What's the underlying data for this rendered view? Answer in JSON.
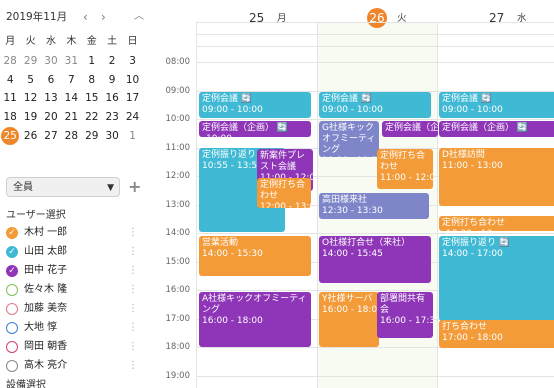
{
  "mini_calendar": {
    "title": "2019年11月",
    "prev": "‹",
    "next": "›",
    "collapse": "︿",
    "weekdays": [
      "月",
      "火",
      "水",
      "木",
      "金",
      "土",
      "日"
    ],
    "weeks": [
      [
        {
          "d": "28",
          "dim": true
        },
        {
          "d": "29",
          "dim": true
        },
        {
          "d": "30",
          "dim": true
        },
        {
          "d": "31",
          "dim": true
        },
        {
          "d": "1"
        },
        {
          "d": "2"
        },
        {
          "d": "3"
        }
      ],
      [
        {
          "d": "4"
        },
        {
          "d": "5"
        },
        {
          "d": "6"
        },
        {
          "d": "7"
        },
        {
          "d": "8"
        },
        {
          "d": "9"
        },
        {
          "d": "10"
        }
      ],
      [
        {
          "d": "11"
        },
        {
          "d": "12"
        },
        {
          "d": "13"
        },
        {
          "d": "14"
        },
        {
          "d": "15"
        },
        {
          "d": "16"
        },
        {
          "d": "17"
        }
      ],
      [
        {
          "d": "18"
        },
        {
          "d": "19"
        },
        {
          "d": "20"
        },
        {
          "d": "21"
        },
        {
          "d": "22"
        },
        {
          "d": "23"
        },
        {
          "d": "24"
        }
      ],
      [
        {
          "d": "25",
          "today": true
        },
        {
          "d": "26"
        },
        {
          "d": "27"
        },
        {
          "d": "28"
        },
        {
          "d": "29"
        },
        {
          "d": "30"
        },
        {
          "d": "1",
          "dim": true
        }
      ]
    ]
  },
  "filter": {
    "label": "全員",
    "add": "+"
  },
  "users_section": {
    "title": "ユーザー選択"
  },
  "users": [
    {
      "name": "木村 一郎",
      "checked": true,
      "color": "#f29b38"
    },
    {
      "name": "山田 太郎",
      "checked": true,
      "color": "#3fb9d4"
    },
    {
      "name": "田中 花子",
      "checked": true,
      "color": "#8e35b8"
    },
    {
      "name": "佐々木 隆",
      "checked": false,
      "color": "#7cc05a"
    },
    {
      "name": "加藤 美奈",
      "checked": false,
      "color": "#e07a8a"
    },
    {
      "name": "大地 惇",
      "checked": false,
      "color": "#3a7fd5"
    },
    {
      "name": "岡田 朝香",
      "checked": false,
      "color": "#d04070"
    },
    {
      "name": "高木 亮介",
      "checked": false,
      "color": "#888888"
    }
  ],
  "equipment_section": {
    "title": "設備選択"
  },
  "days": [
    {
      "num": "25",
      "wd": "月",
      "today": false
    },
    {
      "num": "26",
      "wd": "火",
      "today": true
    },
    {
      "num": "27",
      "wd": "水",
      "today": false
    }
  ],
  "times": [
    "08:00",
    "09:00",
    "10:00",
    "11:00",
    "12:00",
    "13:00",
    "14:00",
    "15:00",
    "16:00",
    "17:00",
    "18:00",
    "19:00"
  ],
  "events": [
    {
      "day": 0,
      "title": "定例会議",
      "time": "09:00 - 10:00",
      "color": "teal",
      "repeat": true
    },
    {
      "day": 0,
      "title": "定例会議（企画）",
      "time": "10:00",
      "color": "purple",
      "repeat": true,
      "one": true
    },
    {
      "day": 0,
      "title": "定例振り返り",
      "time": "10:55 - 13:55",
      "color": "teal",
      "repeat": true
    },
    {
      "day": 0,
      "title": "新案件プレスト会議",
      "time": "11:00 - 12:00",
      "color": "purple"
    },
    {
      "day": 0,
      "title": "定例打ち合わせ",
      "time": "12:00 - 13:00",
      "color": "orange"
    },
    {
      "day": 0,
      "title": "営業活動",
      "time": "14:00 - 15:30",
      "color": "orange"
    },
    {
      "day": 0,
      "title": "A社様キックオフミーティング",
      "time": "16:00 - 18:00",
      "color": "purple"
    },
    {
      "day": 1,
      "title": "定例会議",
      "time": "09:00 - 10:00",
      "color": "teal",
      "repeat": true
    },
    {
      "day": 1,
      "title": "G社様キックオフミーティング",
      "time": "10:00 - 11:30",
      "color": "slate"
    },
    {
      "day": 1,
      "title": "定例会議（企",
      "time": "",
      "color": "purple",
      "one": true
    },
    {
      "day": 1,
      "title": "定例打ち合わせ",
      "time": "11:00 - 12:00",
      "color": "orange"
    },
    {
      "day": 1,
      "title": "高田様来社",
      "time": "12:30 - 13:30",
      "color": "slate"
    },
    {
      "day": 1,
      "title": "O社様打合せ（来社）",
      "time": "14:00 - 15:45",
      "color": "purple"
    },
    {
      "day": 1,
      "title": "Y社様サーバ",
      "time": "16:00 - 18:00",
      "color": "orange"
    },
    {
      "day": 1,
      "title": "部署間共有会",
      "time": "16:00 - 17:3",
      "color": "purple"
    },
    {
      "day": 2,
      "title": "定例会議",
      "time": "09:00 - 10:00",
      "color": "teal",
      "repeat": true
    },
    {
      "day": 2,
      "title": "定例会議（企画）",
      "time": "",
      "color": "purple",
      "repeat": true,
      "one": true
    },
    {
      "day": 2,
      "title": "D社様訪問",
      "time": "11:00 - 13:00",
      "color": "orange"
    },
    {
      "day": 2,
      "title": "定例打ち合わせ",
      "time": "13:20 - 13",
      "color": "orange",
      "one": true
    },
    {
      "day": 2,
      "title": "定例振り返り",
      "time": "14:00 - 17:00",
      "color": "teal",
      "repeat": true
    },
    {
      "day": 2,
      "title": "打ち合わせ",
      "time": "17:00 - 18:00",
      "color": "orange"
    }
  ],
  "repeat_icon": "🔄"
}
